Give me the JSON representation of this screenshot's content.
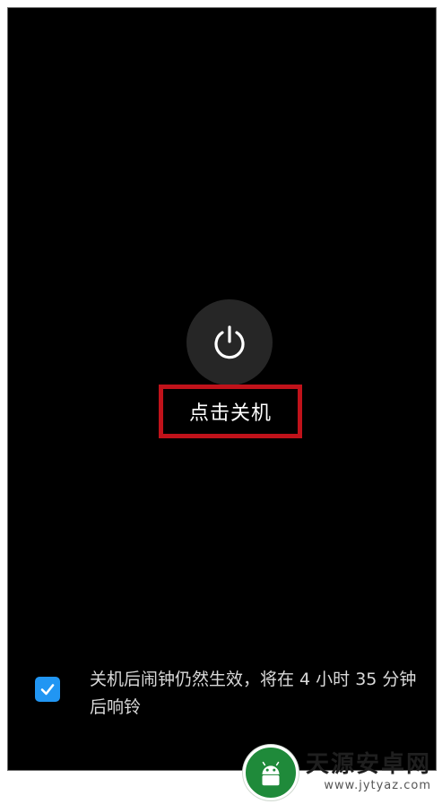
{
  "power_menu": {
    "power_off_label": "点击关机",
    "power_icon": "power-icon"
  },
  "alarm_notice": {
    "checked": true,
    "text": "关机后闹钟仍然生效，将在 4 小时 35 分钟后响铃",
    "check_icon": "checkmark-icon"
  },
  "watermark": {
    "title": "天源安卓网",
    "url": "www.jytyaz.com"
  },
  "colors": {
    "screen_bg": "#000000",
    "power_button_bg": "#262626",
    "highlight_border": "#c0121a",
    "checkbox_blue": "#2196f3"
  }
}
